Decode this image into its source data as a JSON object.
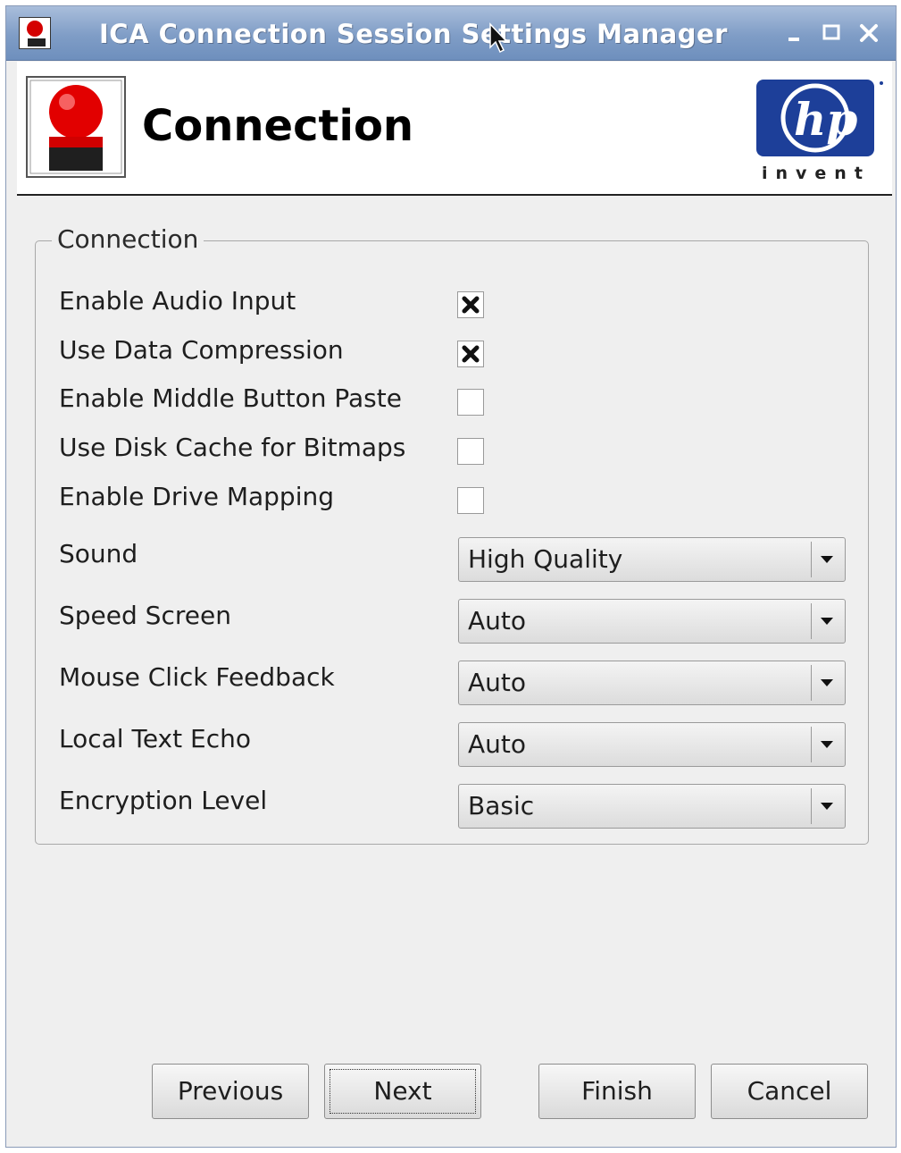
{
  "window": {
    "title": "ICA Connection Session Settings Manager",
    "controls": {
      "minimize": "minimize-icon",
      "maximize": "maximize-icon",
      "close": "close-icon"
    }
  },
  "header": {
    "title": "Connection",
    "icon": "connection-icon",
    "logo": {
      "name": "hp-logo",
      "tagline": "invent"
    }
  },
  "group": {
    "legend": "Connection",
    "checkboxes": [
      {
        "label": "Enable Audio Input",
        "checked": true
      },
      {
        "label": "Use Data Compression",
        "checked": true
      },
      {
        "label": "Enable Middle Button Paste",
        "checked": false
      },
      {
        "label": "Use Disk Cache for Bitmaps",
        "checked": false
      },
      {
        "label": "Enable Drive Mapping",
        "checked": false
      }
    ],
    "dropdowns": [
      {
        "label": "Sound",
        "value": "High Quality"
      },
      {
        "label": "Speed Screen",
        "value": "Auto"
      },
      {
        "label": "Mouse Click Feedback",
        "value": "Auto"
      },
      {
        "label": "Local Text Echo",
        "value": "Auto"
      },
      {
        "label": "Encryption Level",
        "value": "Basic"
      }
    ]
  },
  "buttons": {
    "previous": "Previous",
    "next": "Next",
    "finish": "Finish",
    "cancel": "Cancel"
  },
  "colors": {
    "titlebar": "#7f9dc6",
    "hp_blue": "#1d3f99",
    "window_bg": "#efefef"
  }
}
